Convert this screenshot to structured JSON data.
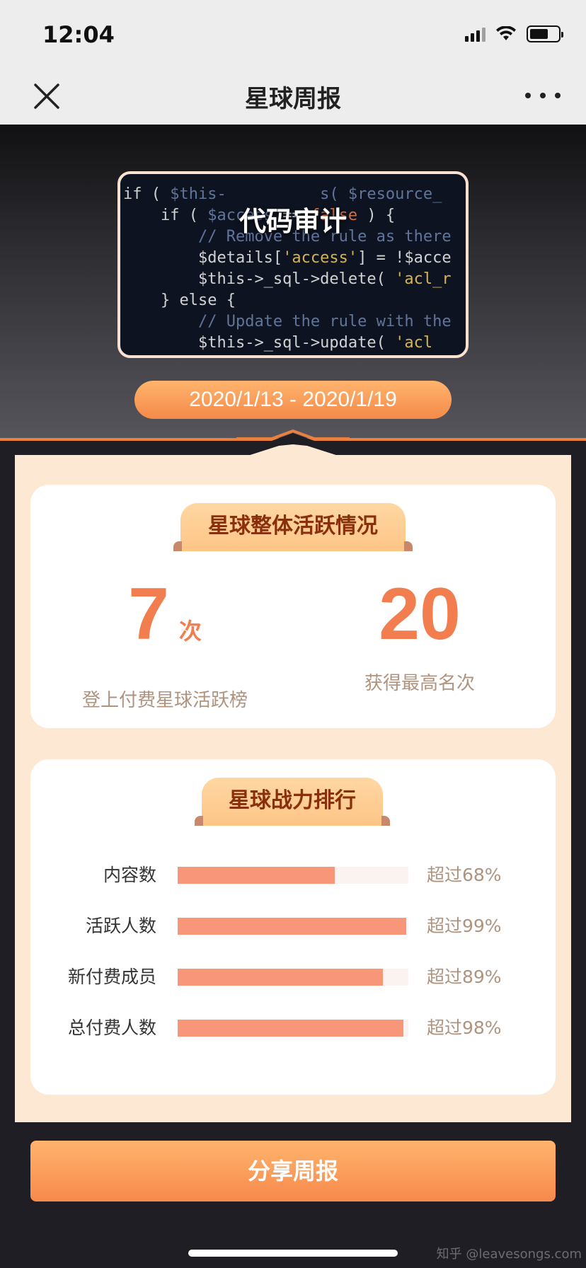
{
  "status_bar": {
    "time": "12:04"
  },
  "nav": {
    "title": "星球周报",
    "close_icon": "close-icon",
    "more_icon": "more-dots-icon"
  },
  "hero": {
    "cover_title": "代码审计",
    "date_range": "2020/1/13 - 2020/1/19"
  },
  "activity": {
    "title": "星球整体活跃情况",
    "times_value": "7",
    "times_unit": "次",
    "times_label": "登上付费星球活跃榜",
    "rank_value": "20",
    "rank_label": "获得最高名次"
  },
  "ranking": {
    "title": "星球战力排行",
    "rows": [
      {
        "label": "内容数",
        "percent": 68,
        "text": "超过68%"
      },
      {
        "label": "活跃人数",
        "percent": 99,
        "text": "超过99%"
      },
      {
        "label": "新付费成员",
        "percent": 89,
        "text": "超过89%"
      },
      {
        "label": "总付费人数",
        "percent": 98,
        "text": "超过98%"
      }
    ]
  },
  "share_button": "分享周报",
  "watermark": "知乎 @leavesongs.com",
  "colors": {
    "accent": "#f27d4e",
    "bar": "#f8967a",
    "cream": "#fde9d3",
    "ribbon_text": "#8a2f0c"
  }
}
